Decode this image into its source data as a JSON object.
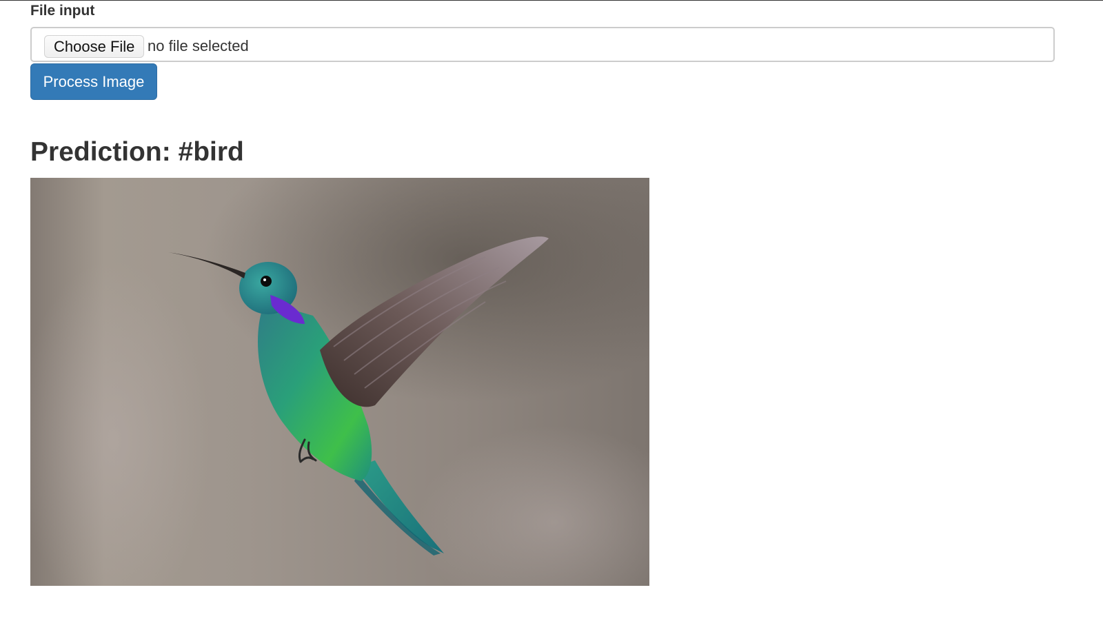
{
  "form": {
    "label": "File input",
    "choose_button_label": "Choose File",
    "file_status": "no file selected",
    "submit_label": "Process Image"
  },
  "result": {
    "prediction": "Prediction: #bird",
    "image_subject": "hummingbird"
  },
  "colors": {
    "primary_button": "#337ab7",
    "input_border": "#cccccc",
    "text": "#333333"
  }
}
